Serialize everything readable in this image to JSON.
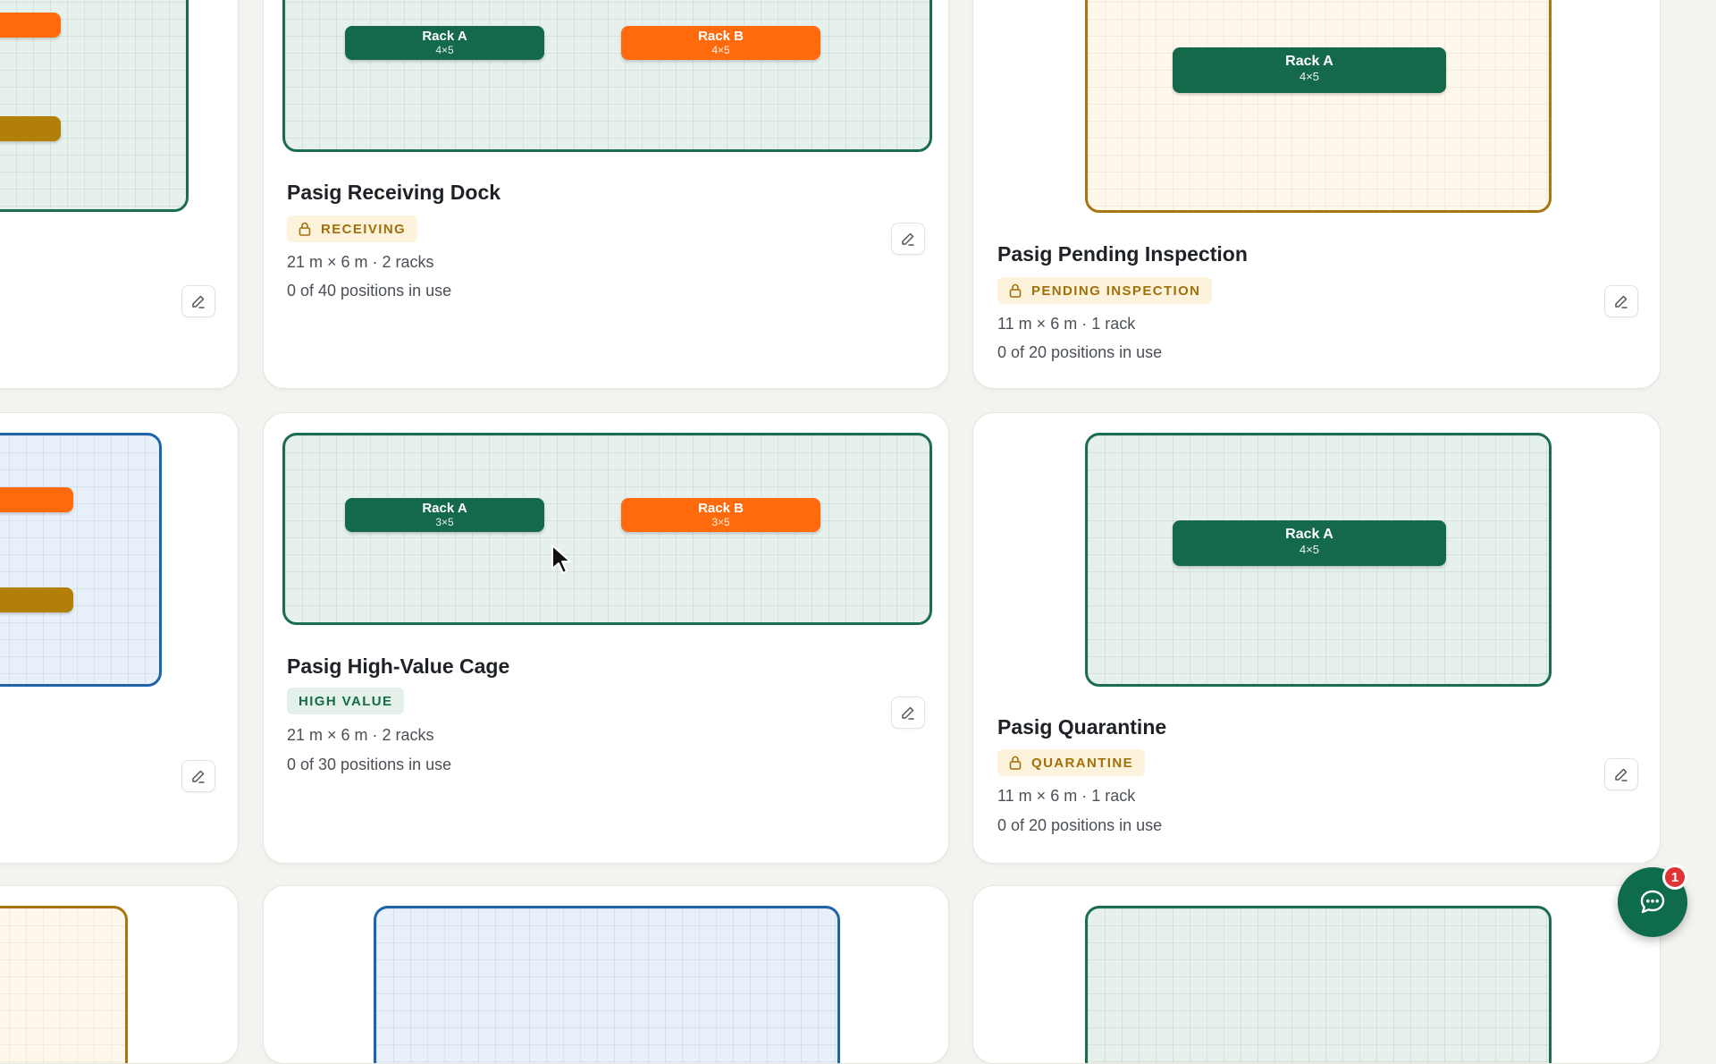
{
  "cards": {
    "left_top": {
      "edit_label": "Edit"
    },
    "receiving": {
      "title": "Pasig Receiving Dock",
      "badge": "RECEIVING",
      "size": "21 m × 6 m · 2 racks",
      "usage": "0 of 40 positions in use",
      "racks": [
        {
          "name": "Rack A",
          "dims": "4×5"
        },
        {
          "name": "Rack B",
          "dims": "4×5"
        }
      ]
    },
    "pending": {
      "title": "Pasig Pending Inspection",
      "badge": "PENDING INSPECTION",
      "size": "11 m × 6 m · 1 rack",
      "usage": "0 of 20 positions in use",
      "racks": [
        {
          "name": "Rack A",
          "dims": "4×5"
        }
      ]
    },
    "high_value": {
      "title": "Pasig High-Value Cage",
      "badge": "HIGH VALUE",
      "size": "21 m × 6 m · 2 racks",
      "usage": "0 of 30 positions in use",
      "racks": [
        {
          "name": "Rack A",
          "dims": "3×5"
        },
        {
          "name": "Rack B",
          "dims": "3×5"
        }
      ]
    },
    "quarantine": {
      "title": "Pasig Quarantine",
      "badge": "QUARANTINE",
      "size": "11 m × 6 m · 1 rack",
      "usage": "0 of 20 positions in use",
      "racks": [
        {
          "name": "Rack A",
          "dims": "4×5"
        }
      ]
    }
  },
  "chat": {
    "unread_count": "1"
  },
  "colors": {
    "brand_green": "#13694a",
    "rack_orange": "#ff6a0d",
    "rack_gold": "#b27f08",
    "pending_border": "#a87610",
    "blue_border": "#1f63a8"
  }
}
